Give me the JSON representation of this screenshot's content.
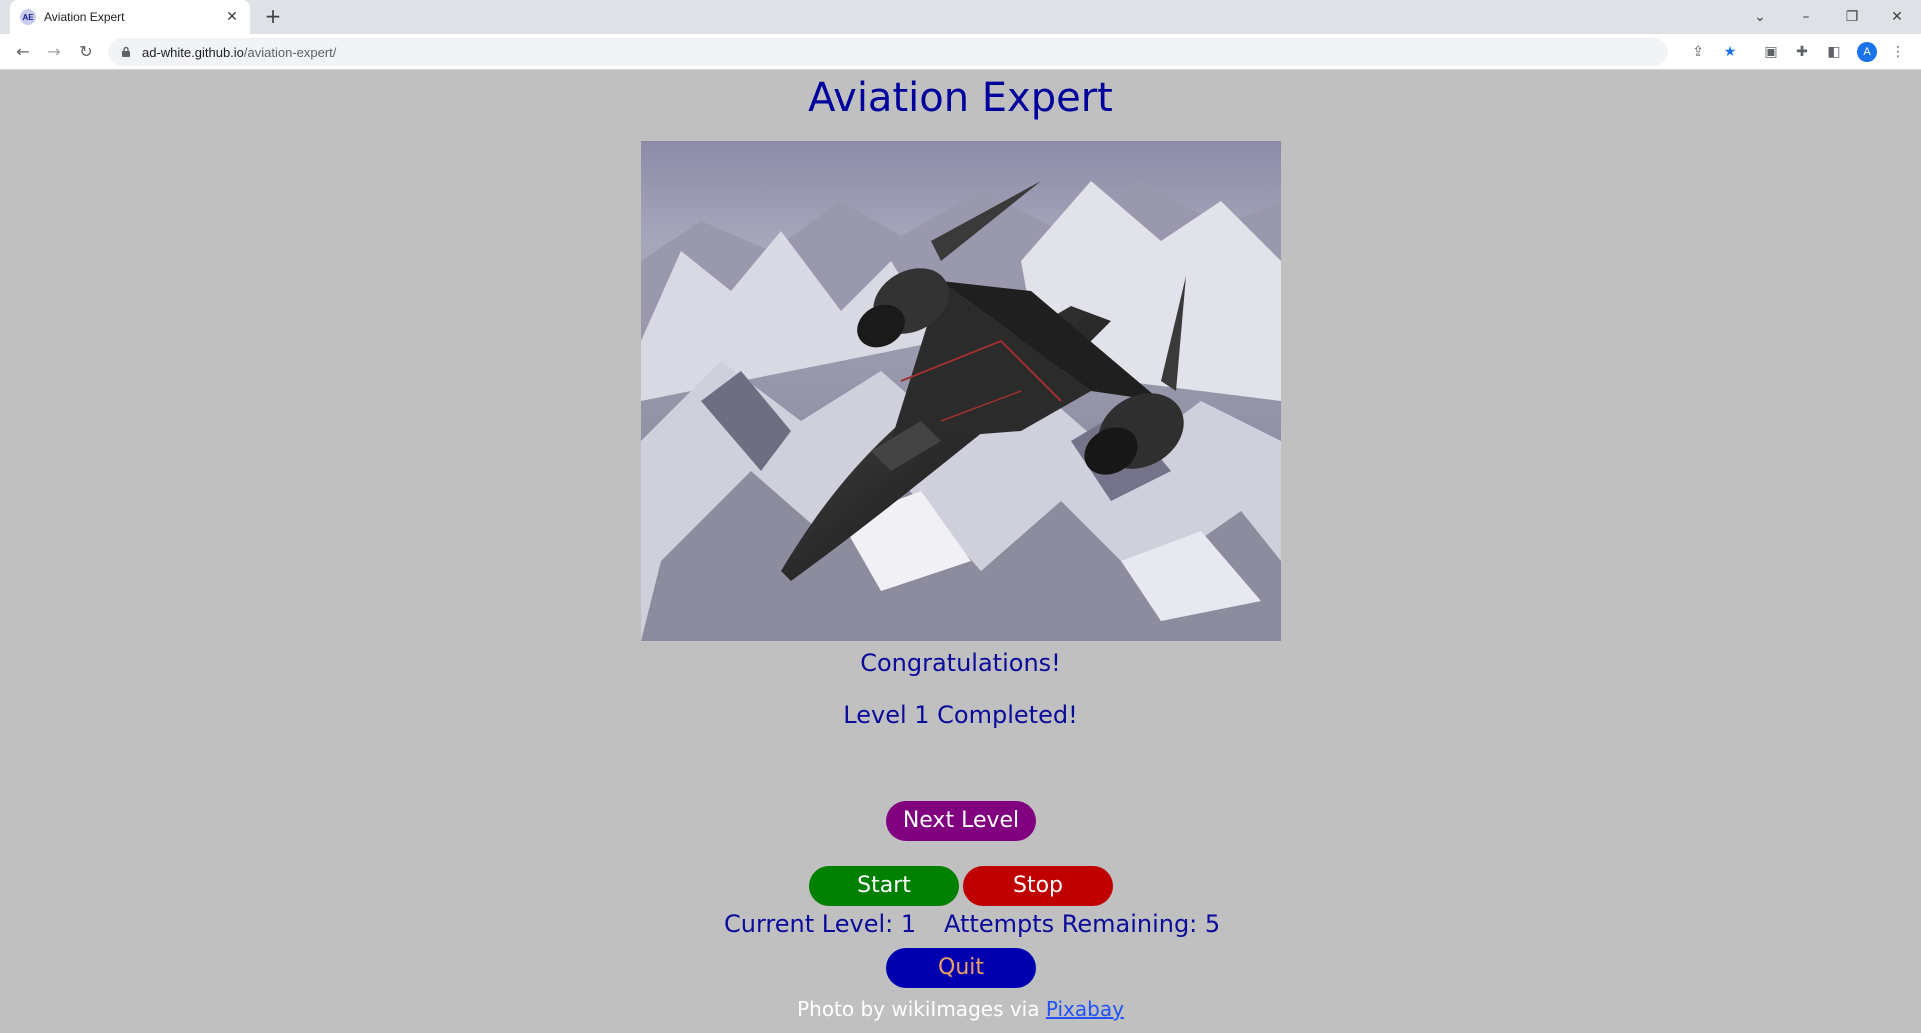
{
  "browser": {
    "tab_title": "Aviation Expert",
    "tab_favicon_text": "AE",
    "url_host": "ad-white.github.io",
    "url_path": "/aviation-expert/",
    "avatar_letter": "A"
  },
  "page": {
    "title": "Aviation Expert",
    "congrats": "Congratulations!",
    "level_completed": "Level 1 Completed!",
    "next_level_label": "Next Level",
    "start_label": "Start",
    "stop_label": "Stop",
    "current_level_text": "Current Level: 1",
    "attempts_text": "Attempts Remaining: 5",
    "quit_label": "Quit",
    "credit_prefix": "Photo by wikiImages via ",
    "credit_link": "Pixabay"
  },
  "colors": {
    "page_bg": "#c0c0c0",
    "title": "#00009c",
    "next_level": "#800080",
    "start": "#008000",
    "stop": "#c00000",
    "quit": "#0000b0"
  }
}
